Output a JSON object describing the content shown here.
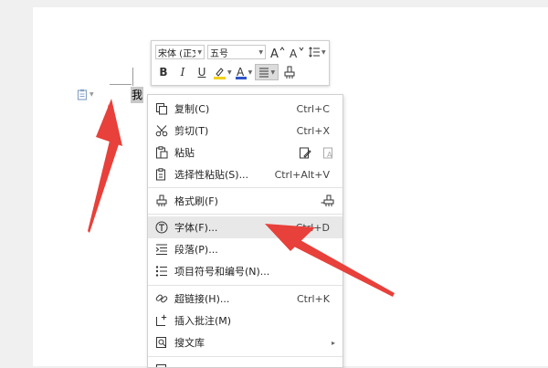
{
  "document": {
    "selected_text": "我"
  },
  "mini_toolbar": {
    "font_name": "宋体 (正文",
    "font_size": "五号",
    "bold_label": "B",
    "italic_label": "I",
    "underline_label": "U"
  },
  "context_menu": {
    "items": [
      {
        "label": "复制(C)",
        "shortcut": "Ctrl+C",
        "icon": "copy-icon"
      },
      {
        "label": "剪切(T)",
        "shortcut": "Ctrl+X",
        "icon": "scissors-icon"
      },
      {
        "label": "粘贴",
        "shortcut": "",
        "icon": "paste-icon"
      },
      {
        "label": "选择性粘贴(S)...",
        "shortcut": "Ctrl+Alt+V",
        "icon": "paste-special-icon"
      },
      {
        "label": "格式刷(F)",
        "shortcut": "",
        "icon": "format-brush-icon"
      },
      {
        "label": "字体(F)...",
        "shortcut": "Ctrl+D",
        "icon": "font-icon"
      },
      {
        "label": "段落(P)...",
        "shortcut": "",
        "icon": "paragraph-icon"
      },
      {
        "label": "项目符号和编号(N)...",
        "shortcut": "",
        "icon": "bullets-numbering-icon"
      },
      {
        "label": "超链接(H)...",
        "shortcut": "Ctrl+K",
        "icon": "hyperlink-icon"
      },
      {
        "label": "插入批注(M)",
        "shortcut": "",
        "icon": "comment-icon"
      },
      {
        "label": "搜文库",
        "shortcut": "",
        "icon": "search-library-icon"
      }
    ]
  },
  "colors": {
    "arrow": "#e8403a",
    "highlight_row": "#e8e8e8",
    "font_color_bar": "#2f54c8",
    "highlight_bar": "#f2d21b"
  }
}
